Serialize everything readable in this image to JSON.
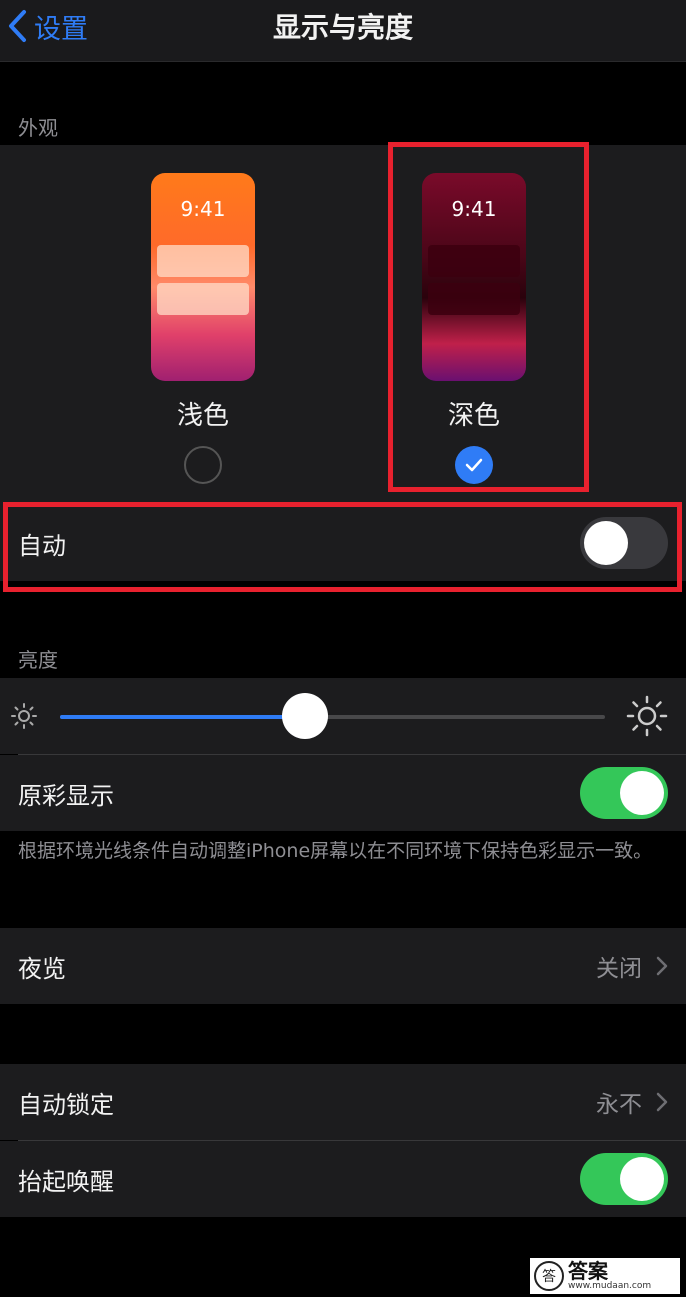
{
  "nav": {
    "back_label": "设置",
    "title": "显示与亮度"
  },
  "appearance": {
    "section_label": "外观",
    "light": {
      "time": "9:41",
      "name": "浅色",
      "selected": false
    },
    "dark": {
      "time": "9:41",
      "name": "深色",
      "selected": true
    },
    "auto_label": "自动",
    "auto_on": false
  },
  "brightness": {
    "section_label": "亮度",
    "level": 0.45,
    "true_tone_label": "原彩显示",
    "true_tone_on": true,
    "true_tone_footnote": "根据环境光线条件自动调整iPhone屏幕以在不同环境下保持色彩显示一致。"
  },
  "night_shift": {
    "label": "夜览",
    "value": "关闭"
  },
  "auto_lock": {
    "label": "自动锁定",
    "value": "永不"
  },
  "raise_to_wake": {
    "label": "抬起唤醒",
    "on": true
  },
  "watermark": {
    "logo": "答",
    "title": "答案",
    "url": "www.mudaan.com"
  },
  "colors": {
    "accent": "#2f7cf6",
    "toggle_on": "#34c759",
    "highlight": "#e8212e",
    "background": "#000000",
    "cell": "#1c1c1e"
  },
  "icons": [
    "chevron-left-icon",
    "checkmark-icon",
    "sun-small-icon",
    "sun-large-icon",
    "chevron-right-icon"
  ]
}
